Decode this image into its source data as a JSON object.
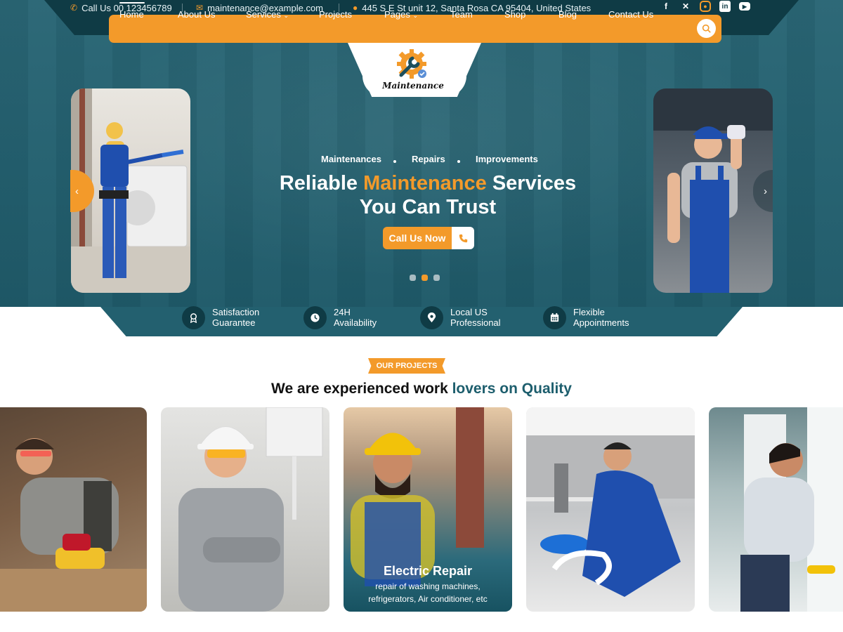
{
  "topbar": {
    "phone": "Call Us 00 123456789",
    "email": "maintenance@example.com",
    "address": "445 S E St unit 12, Santa Rosa CA 95404, United States",
    "social_icons": [
      "facebook-icon",
      "x-icon",
      "instagram-icon",
      "linkedin-icon",
      "youtube-icon"
    ]
  },
  "nav": {
    "items": [
      {
        "label": "Home"
      },
      {
        "label": "About Us"
      },
      {
        "label": "Services"
      },
      {
        "label": "Projects"
      },
      {
        "label": "Pages"
      },
      {
        "label": "Team"
      },
      {
        "label": "Shop"
      },
      {
        "label": "Blog"
      },
      {
        "label": "Contact Us"
      }
    ],
    "active": "Home"
  },
  "logo": {
    "text": "Maintenance"
  },
  "hero": {
    "tags": [
      "Maintenances",
      "Repairs",
      "Improvements"
    ],
    "headline_pre": "Reliable ",
    "headline_accent": "Maintenance",
    "headline_post": " Services",
    "headline_line2": "You Can Trust",
    "cta": "Call Us Now",
    "slides_total": 3,
    "slide_active": 2
  },
  "features": [
    {
      "line1": "Satisfaction",
      "line2": "Guarantee",
      "icon": "award-icon"
    },
    {
      "line1": "24H",
      "line2": "Availability",
      "icon": "clock-icon"
    },
    {
      "line1": "Local US",
      "line2": "Professional",
      "icon": "location-pin-icon"
    },
    {
      "line1": "Flexible",
      "line2": "Appointments",
      "icon": "calendar-icon"
    }
  ],
  "projects": {
    "badge": "OUR PROJECTS",
    "title_pre": "We are experienced work ",
    "title_highlight": "lovers on Quality",
    "featured": {
      "title": "Electric Repair",
      "desc_line1": "repair of washing machines,",
      "desc_line2": "refrigerators, Air conditioner, etc"
    }
  },
  "colors": {
    "accent": "#f39a2a",
    "teal": "#23606f",
    "dark": "#0f3b45"
  }
}
